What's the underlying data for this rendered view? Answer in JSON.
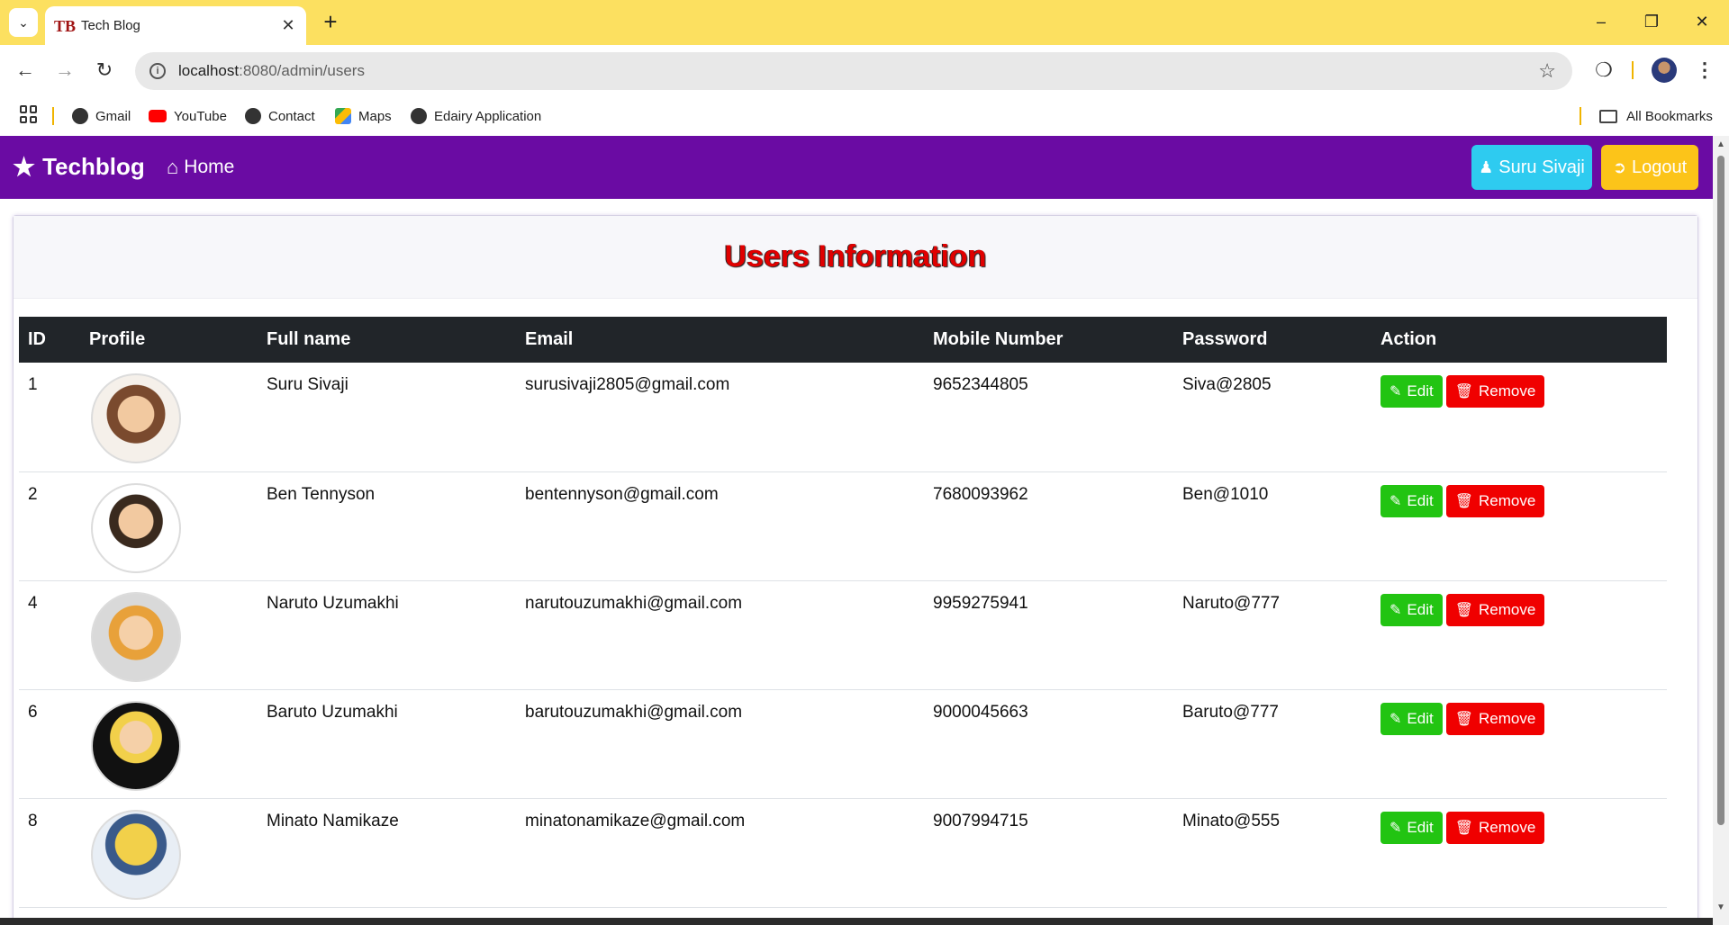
{
  "browser": {
    "tab_title": "Tech Blog",
    "tab_favicon_text": "TB",
    "url_host": "localhost",
    "url_path": ":8080/admin/users",
    "bookmarks": [
      {
        "label": "Gmail",
        "icon": "globe-icon"
      },
      {
        "label": "YouTube",
        "icon": "youtube-icon"
      },
      {
        "label": "Contact",
        "icon": "globe-icon"
      },
      {
        "label": "Maps",
        "icon": "maps-icon"
      },
      {
        "label": "Edairy Application",
        "icon": "globe-icon"
      }
    ],
    "all_bookmarks": "All Bookmarks"
  },
  "navbar": {
    "brand": "Techblog",
    "home": "Home",
    "user_button": "Suru Sivaji",
    "logout_button": "Logout"
  },
  "card": {
    "title": "Users Information"
  },
  "table": {
    "headers": [
      "ID",
      "Profile",
      "Full name",
      "Email",
      "Mobile Number",
      "Password",
      "Action"
    ],
    "edit_label": "Edit",
    "remove_label": "Remove",
    "rows": [
      {
        "id": "1",
        "name": "Suru Sivaji",
        "email": "surusivaji2805@gmail.com",
        "mobile": "9652344805",
        "password": "Siva@2805",
        "avatar_color": "#7a4a2e"
      },
      {
        "id": "2",
        "name": "Ben Tennyson",
        "email": "bentennyson@gmail.com",
        "mobile": "7680093962",
        "password": "Ben@1010",
        "avatar_color": "#3a2a1e"
      },
      {
        "id": "4",
        "name": "Naruto Uzumakhi",
        "email": "narutouzumakhi@gmail.com",
        "mobile": "9959275941",
        "password": "Naruto@777",
        "avatar_color": "#e8a13a"
      },
      {
        "id": "6",
        "name": "Baruto Uzumakhi",
        "email": "barutouzumakhi@gmail.com",
        "mobile": "9000045663",
        "password": "Baruto@777",
        "avatar_color": "#111111"
      },
      {
        "id": "8",
        "name": "Minato Namikaze",
        "email": "minatonamikaze@gmail.com",
        "mobile": "9007994715",
        "password": "Minato@555",
        "avatar_color": "#f2d04a"
      }
    ]
  },
  "colors": {
    "navbar": "#6a0ba3",
    "title_red": "#e00000",
    "edit_green": "#22c412",
    "remove_red": "#f00000",
    "user_btn": "#2ecbf0",
    "logout_btn": "#fcc419"
  }
}
